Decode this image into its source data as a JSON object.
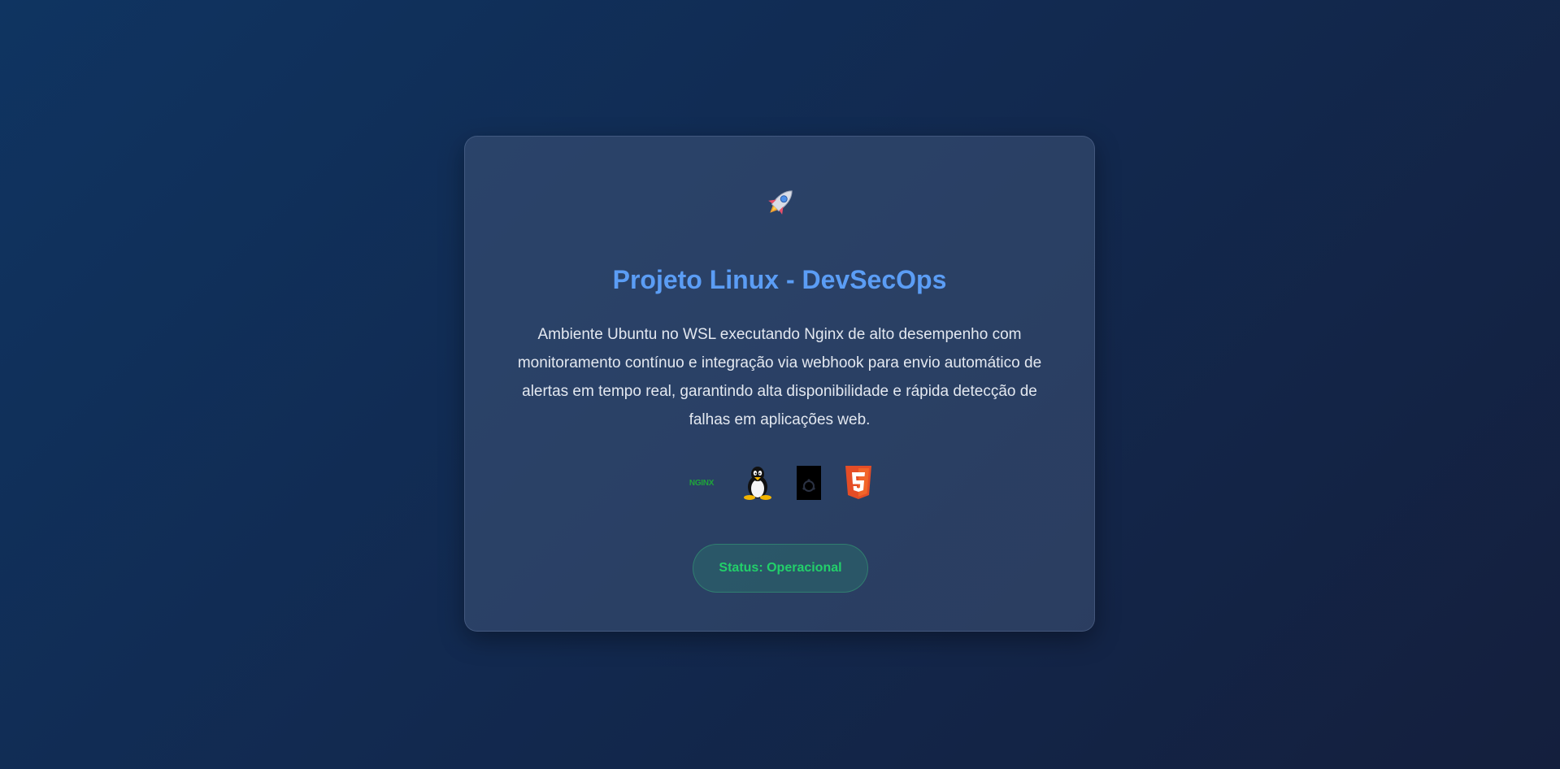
{
  "card": {
    "icon": "rocket-icon",
    "title": "Projeto Linux - DevSecOps",
    "description": "Ambiente Ubuntu no WSL executando Nginx de alto desempenho com monitoramento contínuo e integração via webhook para envio automático de alertas em tempo real, garantindo alta disponibilidade e rápida detecção de falhas em aplicações web.",
    "tech_logos": {
      "nginx": {
        "icon": "nginx-logo-icon",
        "label": "NGINX"
      },
      "linux": {
        "icon": "linux-tux-icon"
      },
      "ubuntu": {
        "icon": "ubuntu-logo-icon"
      },
      "html5": {
        "icon": "html5-logo-icon"
      }
    },
    "status_label": "Status: Operacional"
  },
  "colors": {
    "title": "#5b9df5",
    "status_text": "#22d06a",
    "background_start": "#0f3461",
    "background_end": "#141f3d"
  }
}
